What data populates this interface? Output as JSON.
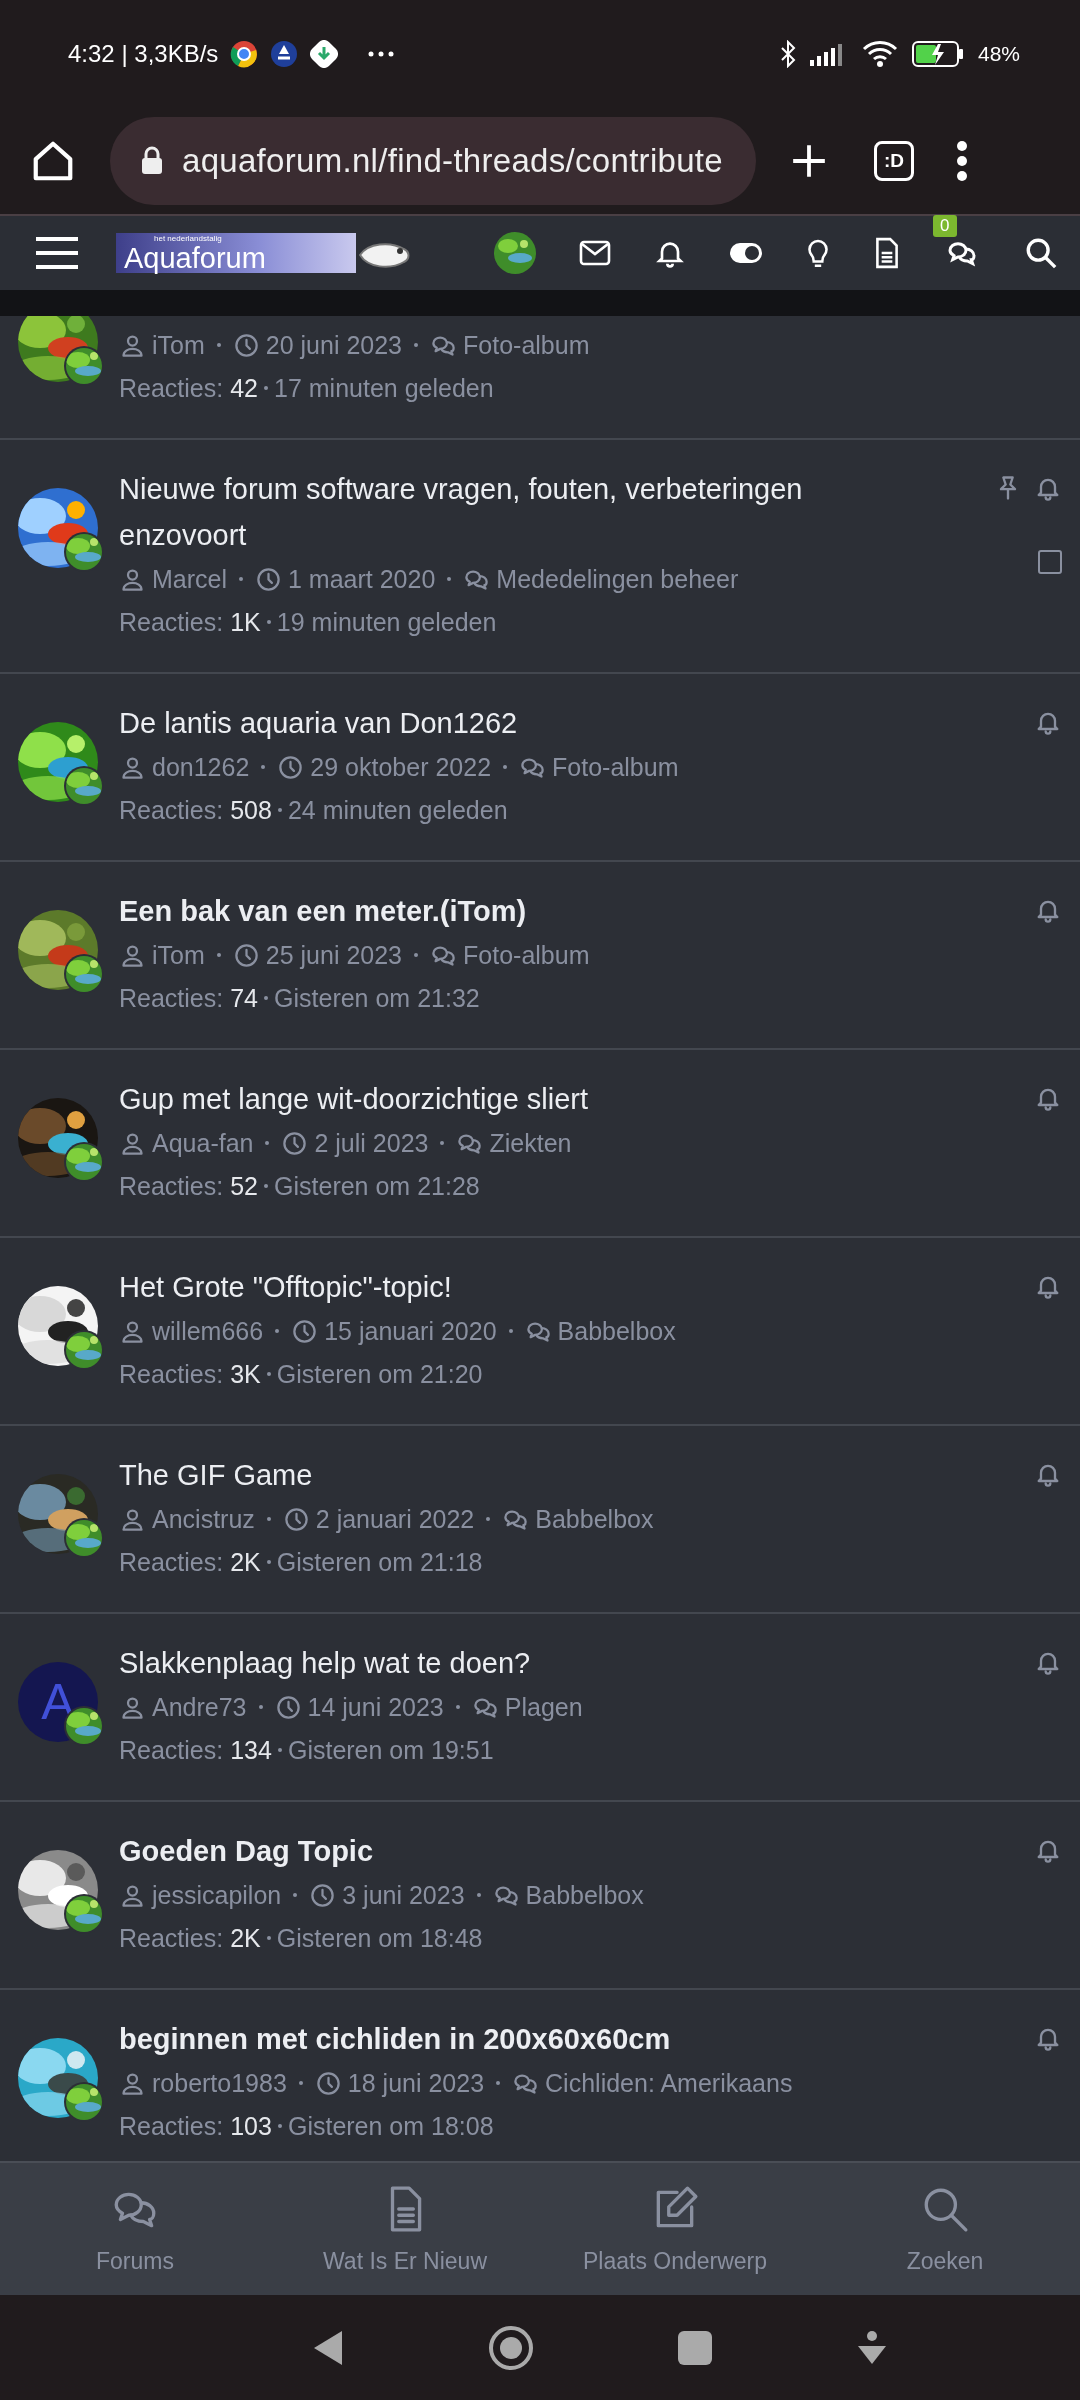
{
  "status_bar": {
    "time": "4:32 | 3,3KB/s",
    "battery": "48%"
  },
  "browser": {
    "url": "aquaforum.nl/find-threads/contribute",
    "tabs_label": ":D"
  },
  "forum_header": {
    "logo_tagline": "het nederlandstalig",
    "logo": "Aquaforum",
    "conversations_badge": "0"
  },
  "threads": [
    {
      "author": "iTom",
      "date": "20 juni 2023",
      "forum": "Foto-album",
      "replies_label": "Reacties:",
      "replies": "42",
      "last_post": "17 minuten geleden"
    },
    {
      "title": "Nieuwe forum software vragen, fouten, verbeteringen enzovoort",
      "author": "Marcel",
      "date": "1 maart 2020",
      "forum": "Mededelingen beheer",
      "replies_label": "Reacties:",
      "replies": "1K",
      "last_post": "19 minuten geleden",
      "unread": false,
      "sticky": true,
      "checkbox": {
        "checked": false
      }
    },
    {
      "title": "De lantis aquaria van Don1262",
      "author": "don1262",
      "date": "29 oktober 2022",
      "forum": "Foto-album",
      "replies_label": "Reacties:",
      "replies": "508",
      "last_post": "24 minuten geleden",
      "unread": false,
      "sticky": false
    },
    {
      "title": "Een bak van een meter.(iTom)",
      "author": "iTom",
      "date": "25 juni 2023",
      "forum": "Foto-album",
      "replies_label": "Reacties:",
      "replies": "74",
      "last_post": "Gisteren om 21:32",
      "unread": true,
      "sticky": false
    },
    {
      "title": "Gup met lange wit-doorzichtige sliert",
      "author": "Aqua-fan",
      "date": "2 juli 2023",
      "forum": "Ziekten",
      "replies_label": "Reacties:",
      "replies": "52",
      "last_post": "Gisteren om 21:28",
      "unread": false,
      "sticky": false
    },
    {
      "title": "Het Grote \"Offtopic\"-topic!",
      "author": "willem666",
      "date": "15 januari 2020",
      "forum": "Babbelbox",
      "replies_label": "Reacties:",
      "replies": "3K",
      "last_post": "Gisteren om 21:20",
      "unread": false,
      "sticky": false
    },
    {
      "title": "The GIF Game",
      "author": "Ancistruz",
      "date": "2 januari 2022",
      "forum": "Babbelbox",
      "replies_label": "Reacties:",
      "replies": "2K",
      "last_post": "Gisteren om 21:18",
      "unread": false,
      "sticky": false
    },
    {
      "title": "Slakkenplaag help wat te doen?",
      "author": "Andre73",
      "date": "14 juni 2023",
      "forum": "Plagen",
      "replies_label": "Reacties:",
      "replies": "134",
      "last_post": "Gisteren om 19:51",
      "unread": false,
      "sticky": false,
      "avatar": {
        "kind": "letter",
        "letter": "A"
      }
    },
    {
      "title": "Goeden Dag Topic",
      "author": "jessicapilon",
      "date": "3 juni 2023",
      "forum": "Babbelbox",
      "replies_label": "Reacties:",
      "replies": "2K",
      "last_post": "Gisteren om 18:48",
      "unread": true,
      "sticky": false
    },
    {
      "title": "beginnen met cichliden in 200x60x60cm",
      "author": "roberto1983",
      "date": "18 juni 2023",
      "forum": "Cichliden: Amerikaans",
      "replies_label": "Reacties:",
      "replies": "103",
      "last_post": "Gisteren om 18:08",
      "unread": true,
      "sticky": false
    }
  ],
  "bottom_nav": [
    {
      "kind": "forums",
      "label": "Forums"
    },
    {
      "kind": "news",
      "label": "Wat Is Er Nieuw"
    },
    {
      "kind": "post",
      "label": "Plaats Onderwerp"
    },
    {
      "kind": "search",
      "label": "Zoeken"
    }
  ]
}
